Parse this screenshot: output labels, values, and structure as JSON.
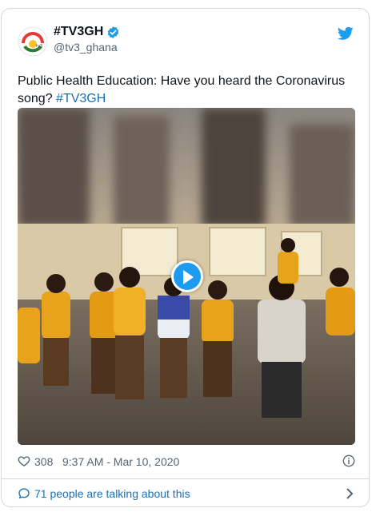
{
  "tweet": {
    "display_name": "#TV3GH",
    "handle": "@tv3_ghana",
    "text_prefix": "Public Health Education: Have you heard the Coronavirus song? ",
    "hashtag": "#TV3GH",
    "likes": "308",
    "timestamp": "9:37 AM - Mar 10, 2020",
    "conversation": "71 people are talking about this"
  },
  "icons": {
    "avatar": "tv3-logo",
    "verified": "verified-badge-icon",
    "brand": "twitter-bird-icon",
    "like": "heart-icon",
    "info": "info-icon",
    "reply": "speech-bubble-icon",
    "more": "chevron-right-icon",
    "play": "play-icon"
  },
  "colors": {
    "accent": "#1d9bf0",
    "link": "#1b6fb3",
    "text": "#0f1419",
    "muted": "#536471",
    "border": "#cfd9de"
  }
}
